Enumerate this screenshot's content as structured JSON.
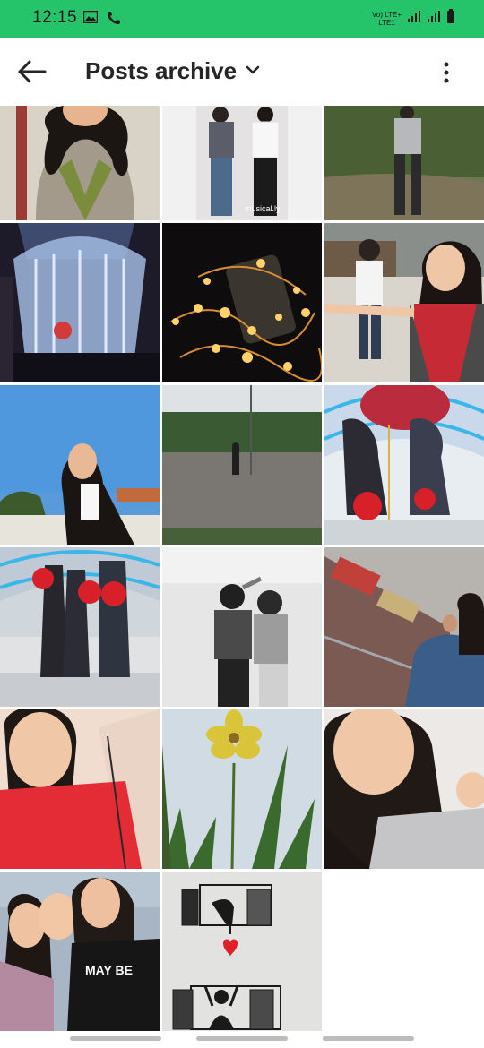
{
  "status_bar": {
    "time": "12:15",
    "network_top": "Vo) LTE+",
    "network_bottom": "LTE1",
    "bg_color": "#25c36a"
  },
  "app_bar": {
    "title": "Posts archive",
    "back_icon": "arrow-left-icon",
    "dropdown_icon": "chevron-down-icon",
    "more_icon": "more-vertical-icon"
  },
  "posts": [
    {
      "caption": ""
    },
    {
      "caption": "musical.ly"
    },
    {
      "caption": ""
    },
    {
      "caption": ""
    },
    {
      "caption": ""
    },
    {
      "caption": ""
    },
    {
      "caption": ""
    },
    {
      "caption": ""
    },
    {
      "caption": ""
    },
    {
      "caption": ""
    },
    {
      "caption": ""
    },
    {
      "caption": ""
    },
    {
      "caption": ""
    },
    {
      "caption": ""
    },
    {
      "caption": ""
    },
    {
      "caption": "MAY BE"
    },
    {
      "caption": ""
    }
  ]
}
